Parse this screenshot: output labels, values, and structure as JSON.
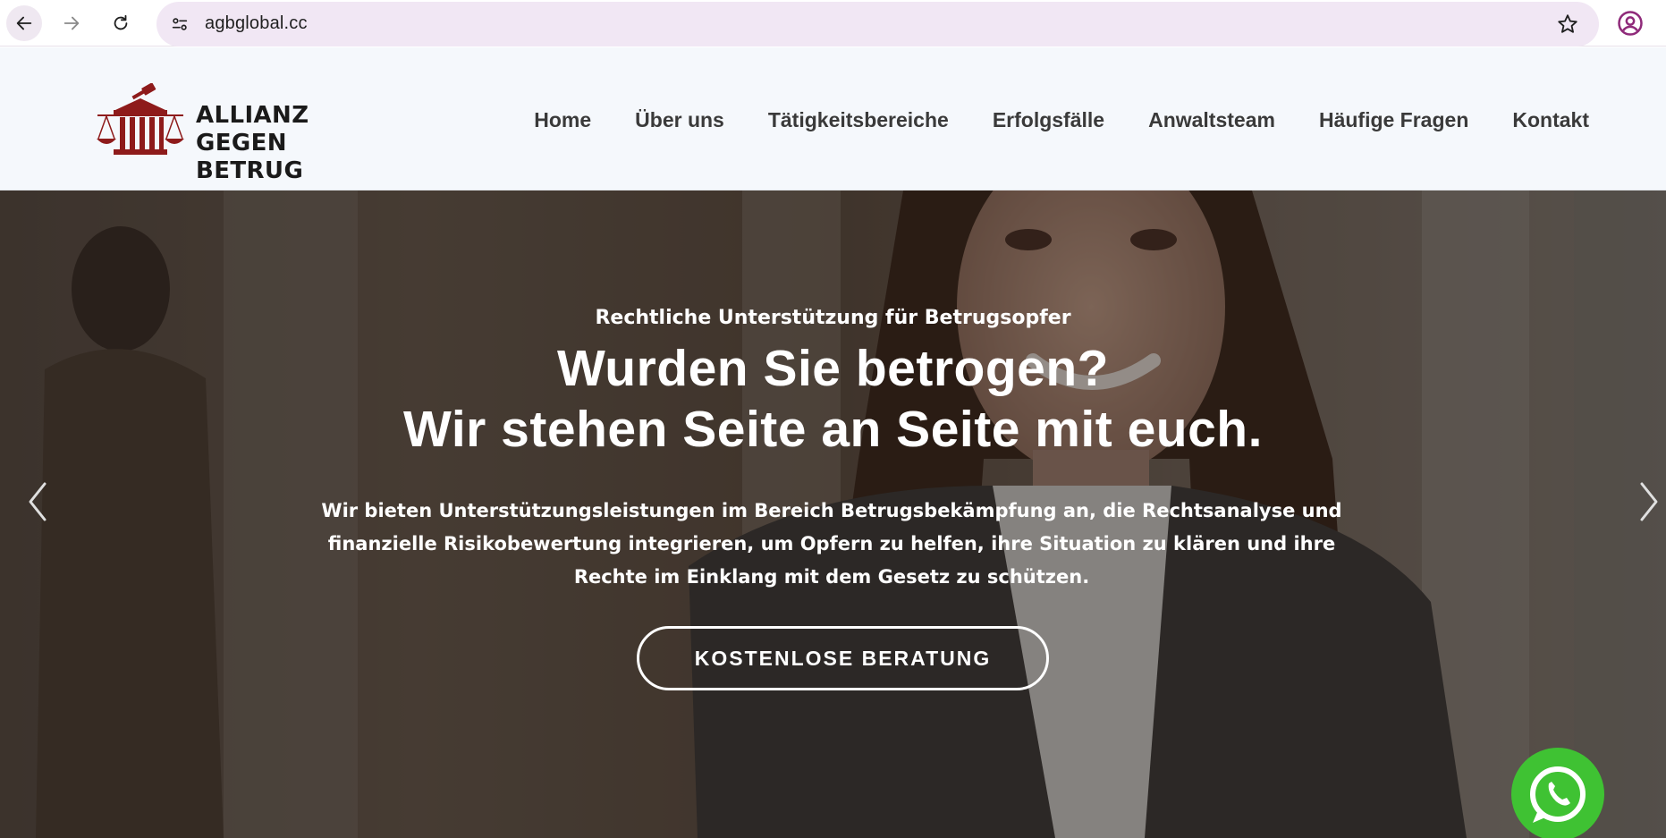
{
  "browser": {
    "url": "agbglobal.cc",
    "icons": [
      "back-arrow-icon",
      "forward-arrow-icon",
      "reload-icon",
      "site-info-icon",
      "star-icon",
      "profile-icon"
    ]
  },
  "header": {
    "logo": {
      "line1": "ALLIANZ",
      "line2": "GEGEN BETRUG"
    },
    "nav": [
      "Home",
      "Über uns",
      "Tätigkeitsbereiche",
      "Erfolgsfälle",
      "Anwaltsteam",
      "Häufige Fragen",
      "Kontakt"
    ]
  },
  "hero": {
    "kicker": "Rechtliche Unterstützung für Betrugsopfer",
    "title_line1": "Wurden Sie betrogen?",
    "title_line2": "Wir stehen Seite an Seite mit euch.",
    "text": "Wir bieten Unterstützungsleistungen im Bereich Betrugsbekämpfung an, die Rechtsanalyse und finanzielle Risikobewertung integrieren, um Opfern zu helfen, ihre Situation zu klären und ihre Rechte im Einklang mit dem Gesetz zu schützen.",
    "cta": "KOSTENLOSE BERATUNG"
  },
  "colors": {
    "brand_red": "#8e1b1b",
    "whatsapp_green": "#3fc233",
    "omnibox": "#f1e7f4"
  }
}
